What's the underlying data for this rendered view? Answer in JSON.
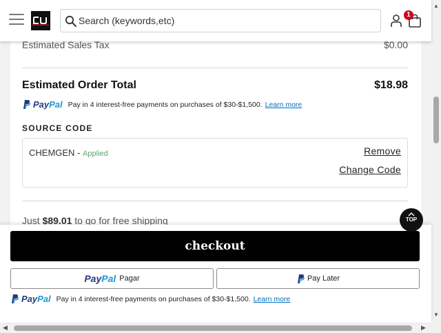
{
  "header": {
    "logo_text": "CU",
    "search_placeholder": "Search (keywords,etc)",
    "cart_count": "1",
    "icons": [
      "menu-icon",
      "search-icon",
      "account-icon",
      "shopping-bag-icon"
    ]
  },
  "summary": {
    "tax_label": "Estimated Sales Tax",
    "tax_value": "$0.00",
    "total_label": "Estimated Order Total",
    "total_value": "$18.98",
    "paypal_message": "Pay in 4 interest-free payments on purchases of $30-$1,500.",
    "paypal_learn_more": "Learn more",
    "source_code_title": "SOURCE CODE",
    "code": "CHEMGEN",
    "code_separator": "-",
    "code_status": "Applied",
    "remove_label": "Remove",
    "change_code_label": "Change Code",
    "shipping_prefix": "Just",
    "shipping_amount": "$89.01",
    "shipping_suffix": "to go for free shipping"
  },
  "top_button": {
    "label": "TOP"
  },
  "footer": {
    "checkout_label": "checkout",
    "paypal_word_a": "Pay",
    "paypal_word_b": "Pal",
    "pagar_label": "Pagar",
    "pay_later_label": "Pay Later",
    "paypal_message": "Pay in 4 interest-free payments on purchases of $30-$1,500.",
    "paypal_learn_more": "Learn more"
  },
  "colors": {
    "paypal_dark": "#253b80",
    "paypal_light": "#179bd7",
    "link": "#0070ba",
    "applied": "#5aa86a",
    "badge": "#d0021b",
    "checkout_bg": "#000000"
  }
}
